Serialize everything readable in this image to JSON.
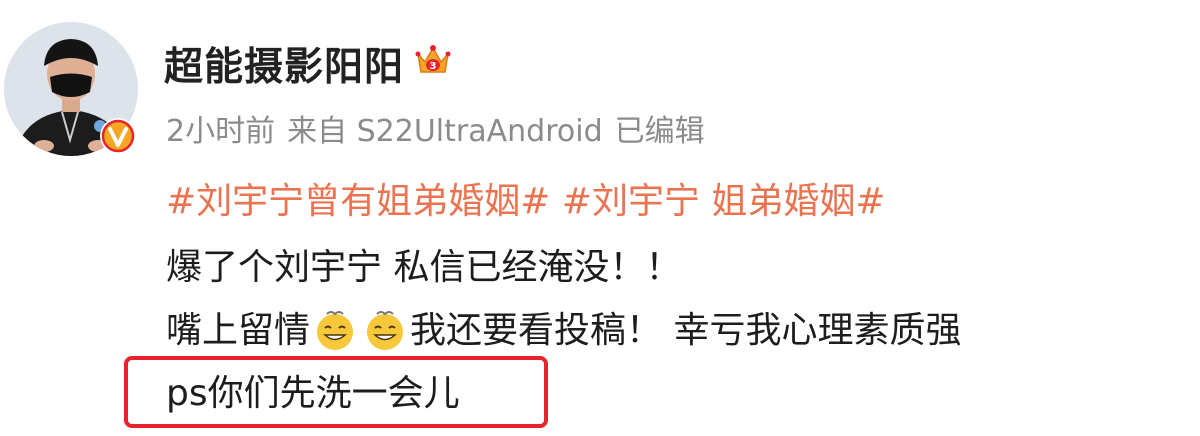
{
  "user": {
    "name": "超能摄影阳阳",
    "avatar_icon": "user-avatar",
    "verified_icon": "orange-v-verified-icon",
    "level_icon": "crown-member-icon",
    "level_text": "3"
  },
  "meta": {
    "time": "2小时前",
    "source": "来自 S22UltraAndroid",
    "edited": "已编辑"
  },
  "post": {
    "hashtag_1": "#刘宇宁曾有姐弟婚姻#",
    "hashtag_2": "#刘宇宁 姐弟婚姻#",
    "line_2": "爆了个刘宇宁 私信已经淹没！！",
    "line_3_a": "嘴上留情",
    "line_3_b": "我还要看投稿！ 幸亏我心理素质强",
    "line_4": "ps你们先洗一会儿",
    "emoji_icon": "dizzy-grin-emoji"
  },
  "colors": {
    "hashtag": "#eb7350",
    "highlight_border": "#e8232b",
    "meta_text": "#8b8b8b"
  }
}
